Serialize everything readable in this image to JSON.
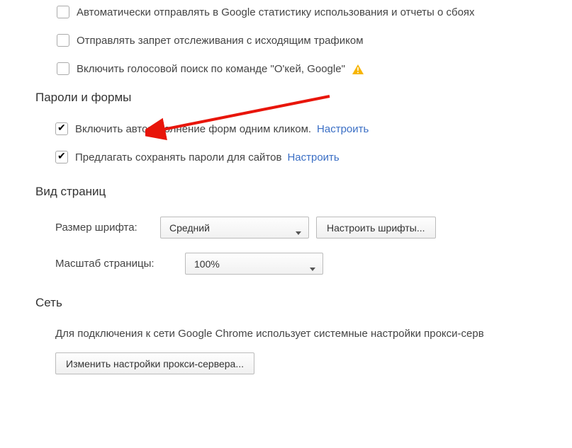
{
  "privacy": {
    "stats_label": "Автоматически отправлять в Google статистику использования и отчеты о сбоях",
    "dnt_label": "Отправлять запрет отслеживания с исходящим трафиком",
    "voice_label": "Включить голосовой поиск по команде \"О'кей, Google\""
  },
  "passwords_section": {
    "title": "Пароли и формы",
    "autofill_label": "Включить автозаполнение форм одним кликом.",
    "autofill_configure": "Настроить",
    "save_pw_label": "Предлагать сохранять пароли для сайтов",
    "save_pw_configure": "Настроить"
  },
  "appearance_section": {
    "title": "Вид страниц",
    "font_size_label": "Размер шрифта:",
    "font_size_value": "Средний",
    "customize_fonts_btn": "Настроить шрифты...",
    "zoom_label": "Масштаб страницы:",
    "zoom_value": "100%"
  },
  "network_section": {
    "title": "Сеть",
    "description": "Для подключения к сети Google Chrome использует системные настройки прокси-серв",
    "proxy_btn": "Изменить настройки прокси-сервера..."
  }
}
